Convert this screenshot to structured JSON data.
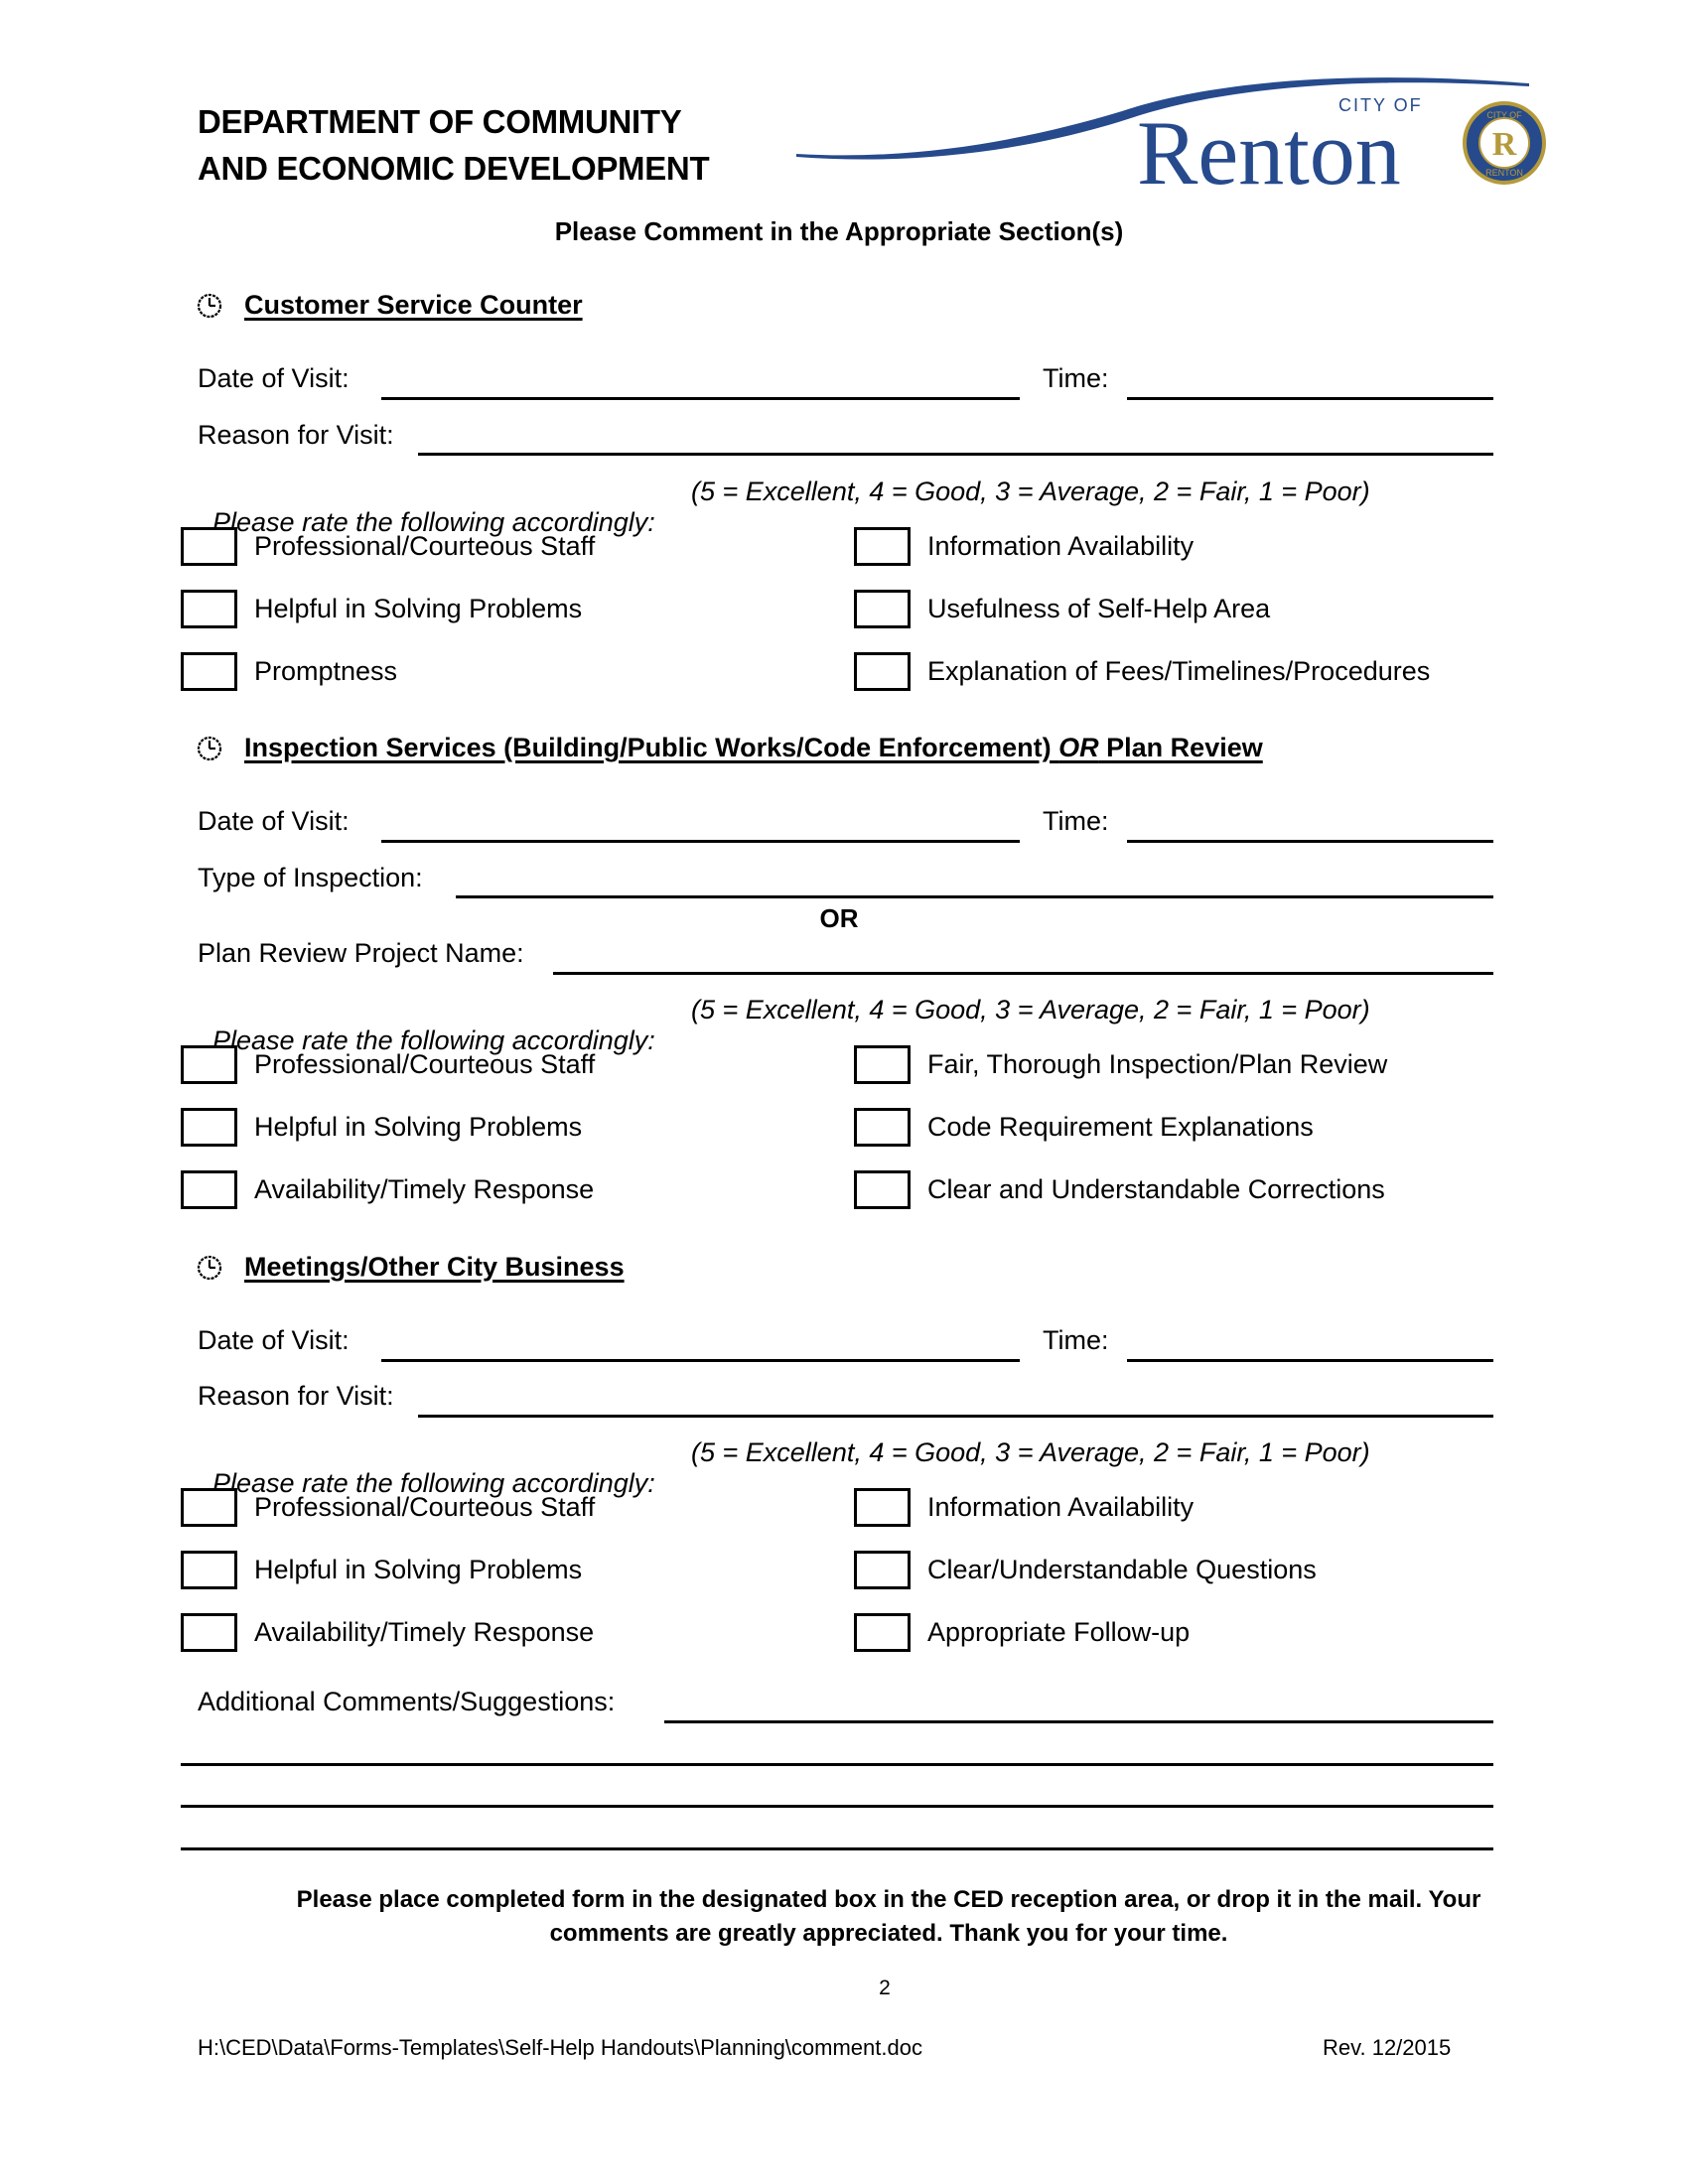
{
  "header": {
    "dept_line1": "DEPARTMENT OF COMMUNITY",
    "dept_line2": "AND ECONOMIC DEVELOPMENT",
    "logo": {
      "city_of": "CITY OF",
      "name": "Renton",
      "seal_top": "CITY OF",
      "seal_bottom": "RENTON",
      "brand_color": "#264a8c",
      "seal_gold": "#b59a3b"
    }
  },
  "subtitle": "Please Comment in the Appropriate Section(s)",
  "rating_prompt": "Please rate the following accordingly:",
  "rating_scale": "(5 = Excellent, 4 = Good, 3 = Average, 2 = Fair, 1 = Poor)",
  "sections": [
    {
      "icon": "clock-icon",
      "title": "Customer Service Counter",
      "date_label": "Date of Visit:",
      "date_value": "",
      "time_label": "Time:",
      "time_value": "",
      "reason_label": "Reason for Visit:",
      "reason_value": "",
      "ratings_left": [
        "Professional/Courteous Staff",
        "Helpful in Solving Problems",
        "Promptness"
      ],
      "ratings_right": [
        "Information Availability",
        "Usefulness of Self-Help Area",
        "Explanation of Fees/Timelines/Procedures"
      ]
    },
    {
      "icon": "clock-icon",
      "title_part1": "Inspection Services (Building/Public Works/Code Enforcement) ",
      "title_or": "OR",
      "title_part2": " Plan Review",
      "date_label": "Date of Visit:",
      "date_value": "",
      "time_label": "Time:",
      "time_value": "",
      "type_label": "Type of Inspection:",
      "type_value": "",
      "or_label": "OR",
      "project_label": "Plan Review Project Name:",
      "project_value": "",
      "ratings_left": [
        "Professional/Courteous Staff",
        "Helpful in Solving Problems",
        "Availability/Timely Response"
      ],
      "ratings_right": [
        "Fair, Thorough Inspection/Plan Review",
        "Code Requirement Explanations",
        "Clear and Understandable Corrections"
      ]
    },
    {
      "icon": "clock-icon",
      "title": "Meetings/Other City Business",
      "date_label": "Date of Visit:",
      "date_value": "",
      "time_label": "Time:",
      "time_value": "",
      "reason_label": "Reason for Visit:",
      "reason_value": "",
      "ratings_left": [
        "Professional/Courteous Staff",
        "Helpful in Solving Problems",
        "Availability/Timely Response"
      ],
      "ratings_right": [
        "Information Availability",
        "Clear/Understandable Questions",
        "Appropriate Follow-up"
      ]
    }
  ],
  "comments": {
    "label": "Additional Comments/Suggestions:",
    "value": ""
  },
  "footer": {
    "note_line1": "Please place completed form in the designated box in the CED reception area, or drop it in the mail.  Your",
    "note_line2": "comments are greatly appreciated.  Thank you for your time.",
    "page_number": "2",
    "file_path": "H:\\CED\\Data\\Forms-Templates\\Self-Help Handouts\\Planning\\comment.doc",
    "revision": "Rev. 12/2015"
  }
}
